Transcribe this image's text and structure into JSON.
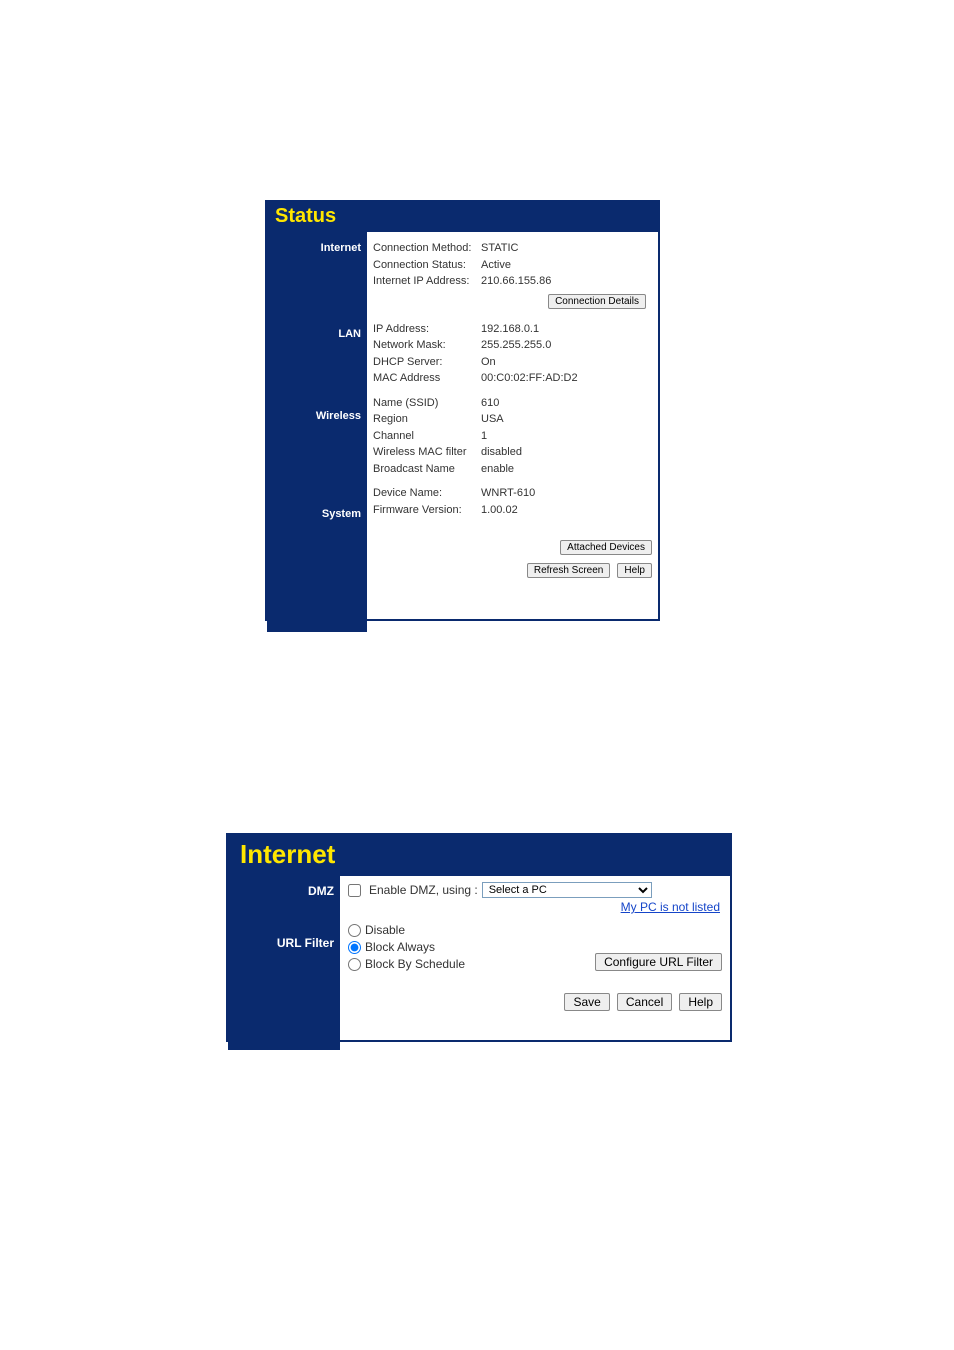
{
  "status_panel": {
    "title": "Status",
    "internet": {
      "label": "Internet",
      "rows": {
        "connection_method": {
          "lbl": "Connection Method:",
          "val": "STATIC"
        },
        "connection_status": {
          "lbl": "Connection Status:",
          "val": "Active"
        },
        "internet_ip": {
          "lbl": "Internet IP Address:",
          "val": "210.66.155.86"
        }
      },
      "connection_details_btn": "Connection Details"
    },
    "lan": {
      "label": "LAN",
      "rows": {
        "ip_address": {
          "lbl": "IP Address:",
          "val": "192.168.0.1"
        },
        "network_mask": {
          "lbl": "Network Mask:",
          "val": "255.255.255.0"
        },
        "dhcp_server": {
          "lbl": "DHCP Server:",
          "val": "On"
        },
        "mac_address": {
          "lbl": "MAC Address",
          "val": "00:C0:02:FF:AD:D2"
        }
      }
    },
    "wireless": {
      "label": "Wireless",
      "rows": {
        "ssid": {
          "lbl": "Name (SSID)",
          "val": "610"
        },
        "region": {
          "lbl": "Region",
          "val": "USA"
        },
        "channel": {
          "lbl": "Channel",
          "val": "1"
        },
        "macfilter": {
          "lbl": "Wireless MAC filter",
          "val": "disabled"
        },
        "bcast": {
          "lbl": "Broadcast Name",
          "val": "enable"
        }
      }
    },
    "system": {
      "label": "System",
      "rows": {
        "device_name": {
          "lbl": "Device Name:",
          "val": "WNRT-610"
        },
        "firmware": {
          "lbl": "Firmware Version:",
          "val": "1.00.02"
        }
      }
    },
    "buttons": {
      "attached_devices": "Attached Devices",
      "refresh": "Refresh Screen",
      "help": "Help"
    }
  },
  "internet_panel": {
    "title": "Internet",
    "dmz": {
      "label": "DMZ",
      "checkbox_label": "Enable DMZ, using :",
      "select_value": "Select a PC",
      "my_pc_link": "My PC is not listed"
    },
    "url_filter": {
      "label": "URL Filter",
      "options": {
        "disable": "Disable",
        "block_always": "Block Always",
        "block_schedule": "Block By Schedule"
      },
      "configure_btn": "Configure URL Filter"
    },
    "footer": {
      "save": "Save",
      "cancel": "Cancel",
      "help": "Help"
    }
  }
}
